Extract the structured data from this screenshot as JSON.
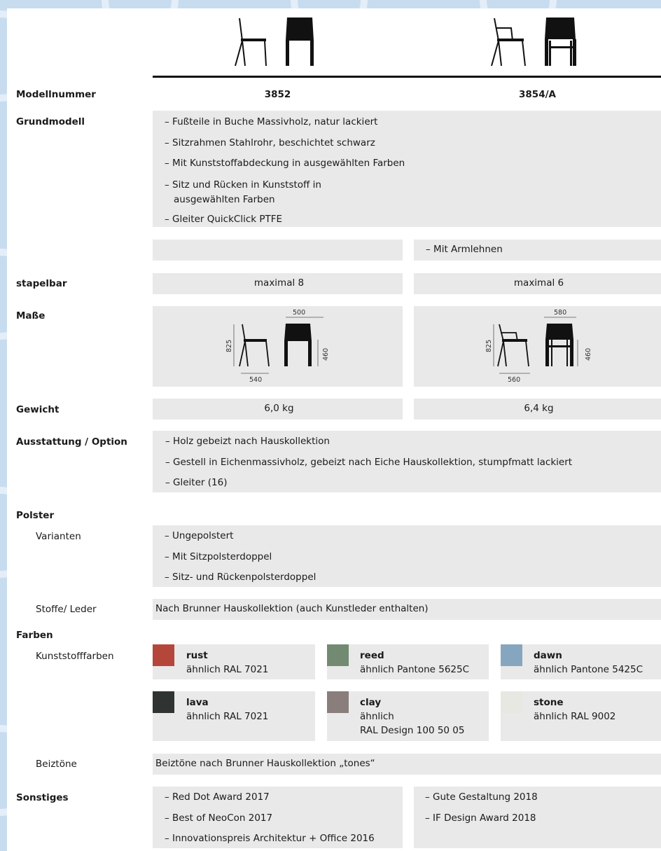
{
  "rows": {
    "modellnummer": {
      "label": "Modellnummer",
      "values": [
        "3852",
        "3854/A"
      ]
    },
    "grundmodell": {
      "label": "Grundmodell",
      "items": [
        "– Fußteile in Buche Massivholz, natur lackiert",
        "– Sitzrahmen Stahlrohr, beschichtet schwarz",
        "– Mit Kunststoffabdeckung in ausgewählten Farben",
        "– Sitz und Rücken in Kunststoff in",
        "ausgewählten Farben",
        "– Gleiter QuickClick PTFE"
      ]
    },
    "armlehnen": {
      "right": "– Mit Armlehnen"
    },
    "stapelbar": {
      "label": "stapelbar",
      "values": [
        "maximal 8",
        "maximal 6"
      ]
    },
    "masse": {
      "label": "Maße",
      "left": {
        "height": "825",
        "width": "500",
        "depth": "540",
        "seat": "460"
      },
      "right": {
        "height": "825",
        "width": "580",
        "depth": "560",
        "seat": "460"
      }
    },
    "gewicht": {
      "label": "Gewicht",
      "values": [
        "6,0 kg",
        "6,4 kg"
      ]
    },
    "ausstattung": {
      "label": "Ausstattung / Option",
      "items": [
        "–  Holz gebeizt nach Hauskollektion",
        "–  Gestell in Eichenmassivholz, gebeizt nach Eiche Hauskollektion, stumpfmatt lackiert",
        "–  Gleiter (16)"
      ]
    },
    "polster": {
      "label": "Polster",
      "varianten_label": "Varianten",
      "varianten": [
        "– Ungepolstert",
        "– Mit Sitzpolsterdoppel",
        "– Sitz- und Rückenpolsterdoppel"
      ],
      "stoffe_label": "Stoffe/ Leder",
      "stoffe": "Nach Brunner Hauskollektion (auch Kunstleder enthalten)"
    },
    "farben": {
      "label": "Farben",
      "kunststoff_label": "Kunststofffarben",
      "colors": [
        {
          "name": "rust",
          "desc": [
            "ähnlich RAL 7021"
          ],
          "hex": "#b5473a"
        },
        {
          "name": "reed",
          "desc": [
            "ähnlich Pantone 5625C"
          ],
          "hex": "#738a72"
        },
        {
          "name": "dawn",
          "desc": [
            "ähnlich Pantone 5425C"
          ],
          "hex": "#86a6c0"
        },
        {
          "name": "lava",
          "desc": [
            "ähnlich RAL 7021"
          ],
          "hex": "#2f3432"
        },
        {
          "name": "clay",
          "desc": [
            "ähnlich",
            "RAL Design 100 50 05"
          ],
          "hex": "#8a7e7c"
        },
        {
          "name": "stone",
          "desc": [
            "ähnlich RAL 9002"
          ],
          "hex": "#e8e8e2"
        }
      ],
      "beiz_label": "Beiztöne",
      "beiz": "Beiztöne nach Brunner Hauskollektion „tones“"
    },
    "sonstiges": {
      "label": "Sonstiges",
      "left": [
        "– Red Dot Award 2017",
        "– Best of NeoCon 2017",
        "– Innovationspreis Architektur + Office 2016"
      ],
      "right": [
        "– Gute Gestaltung 2018",
        "– IF Design Award 2018"
      ]
    }
  }
}
